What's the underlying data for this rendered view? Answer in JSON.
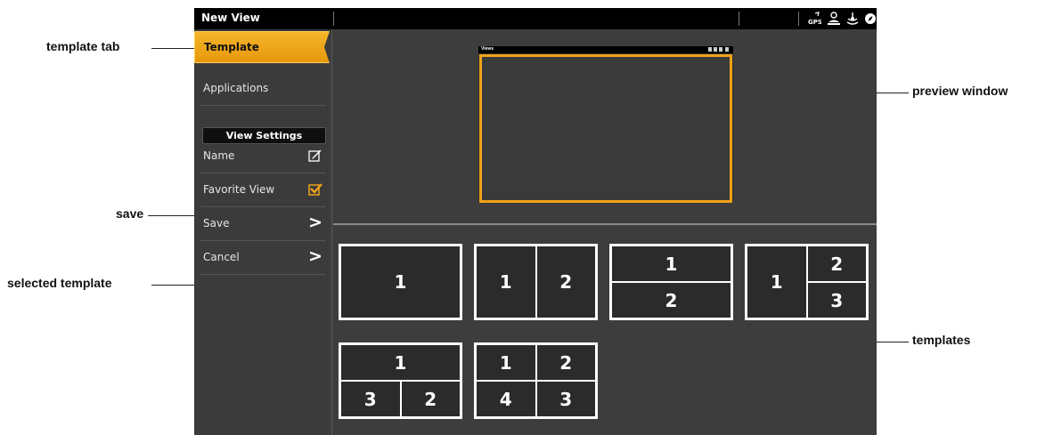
{
  "window": {
    "title": "New View"
  },
  "status_icons": [
    "gps-icon",
    "user-icon",
    "sonar-icon",
    "compass-icon"
  ],
  "menu": {
    "template_tab": "Template",
    "applications": "Applications",
    "view_settings": "View Settings",
    "name": "Name",
    "favorite_view": "Favorite View",
    "save": "Save",
    "cancel": "Cancel",
    "chevron": ">"
  },
  "preview": {
    "title": "Views",
    "accent_color": "#f0a21a"
  },
  "templates": [
    {
      "id": "single",
      "cells": [
        "1"
      ]
    },
    {
      "id": "two-vertical",
      "cells": [
        "1",
        "2"
      ]
    },
    {
      "id": "two-horizontal",
      "cells": [
        "1",
        "2"
      ]
    },
    {
      "id": "three-right-split",
      "cells": [
        "1",
        "2",
        "3"
      ]
    },
    {
      "id": "three-bottom-split",
      "cells": [
        "1",
        "3",
        "2"
      ]
    },
    {
      "id": "four-quad",
      "cells": [
        "1",
        "2",
        "4",
        "3"
      ]
    }
  ],
  "callouts": {
    "template_tab": "template tab",
    "save": "save",
    "selected_template": "selected template",
    "preview_window": "preview window",
    "templates": "templates"
  }
}
